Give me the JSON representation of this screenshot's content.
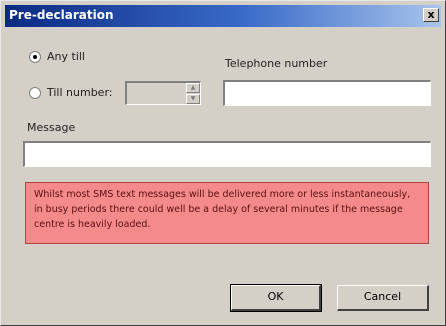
{
  "window": {
    "title": "Pre-declaration",
    "close_label": "x"
  },
  "options": {
    "any_till_label": "Any till",
    "any_till_selected": true,
    "till_number_label": "Till number:",
    "till_number_selected": false,
    "till_number_value": ""
  },
  "telephone": {
    "label": "Telephone number",
    "value": ""
  },
  "message": {
    "label": "Message",
    "value": ""
  },
  "warning": {
    "text": "Whilst most SMS text messages will be delivered more or less instantaneously, in busy periods there could well be a delay of several minutes if the message centre is heavily loaded.",
    "color": "#f58a8a"
  },
  "buttons": {
    "ok_label": "OK",
    "cancel_label": "Cancel"
  },
  "icons": {
    "spin_up": "up-arrow-icon",
    "spin_down": "down-arrow-icon",
    "close": "close-icon"
  }
}
